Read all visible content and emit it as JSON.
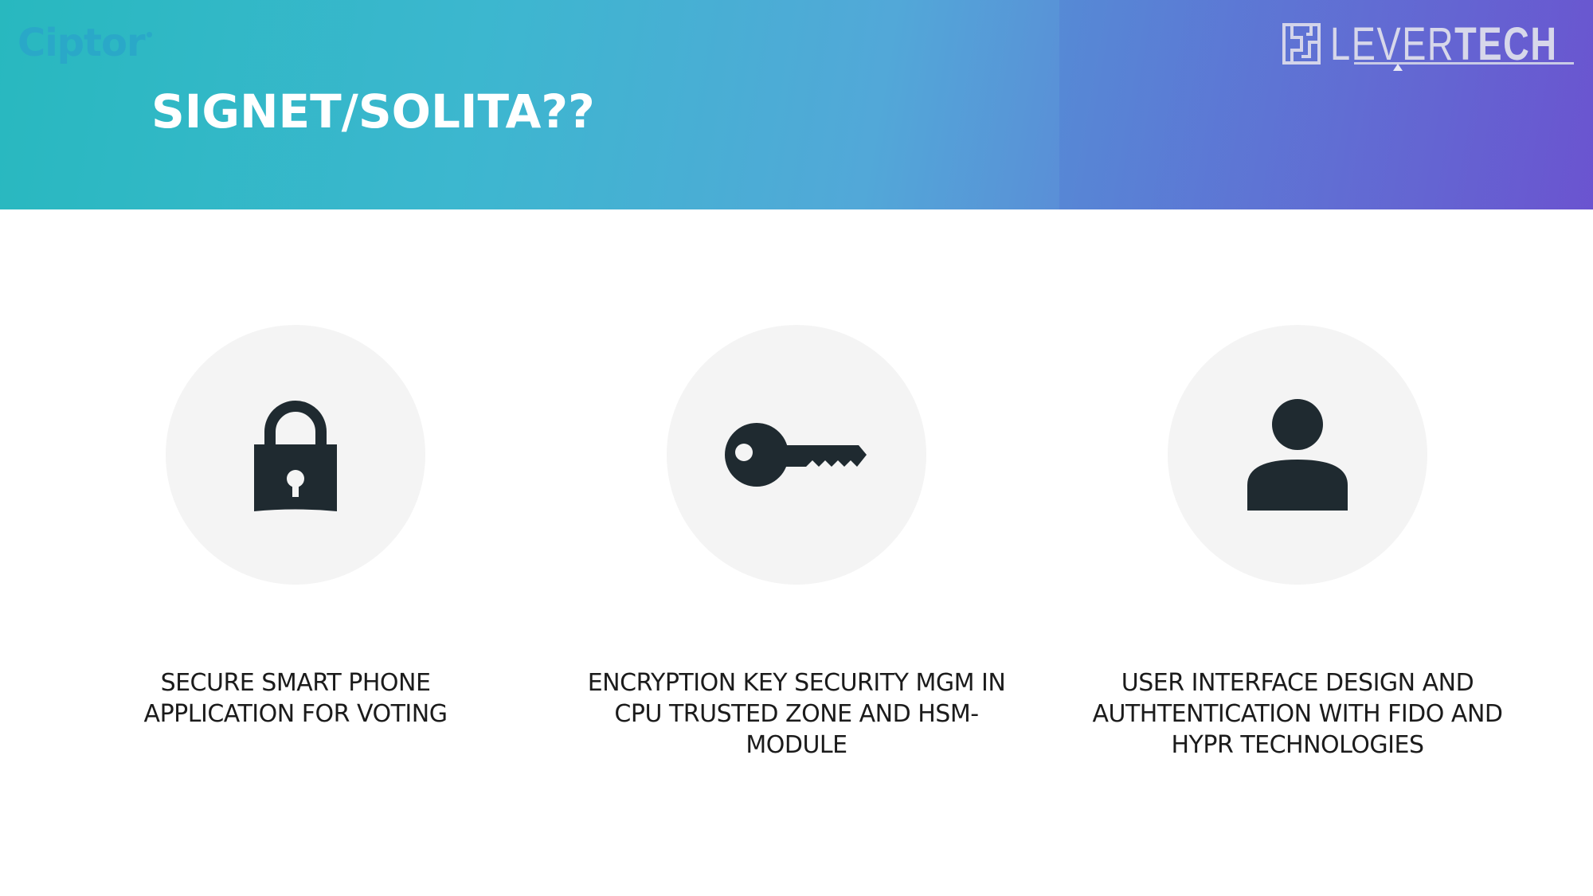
{
  "header": {
    "title": "SIGNET/SOLITA??",
    "left_logo_text": "Ciptor",
    "right_logo_text_light": "LEVER",
    "right_logo_text_bold": "TECH"
  },
  "features": [
    {
      "icon": "lock-icon",
      "caption": "SECURE SMART PHONE\nAPPLICATION FOR VOTING"
    },
    {
      "icon": "key-icon",
      "caption": "ENCRYPTION KEY SECURITY MGM IN\nCPU TRUSTED ZONE AND HSM-\nMODULE"
    },
    {
      "icon": "user-icon",
      "caption": "USER INTERFACE DESIGN AND\nAUTHTENTICATION WITH FIDO AND\nHYPR TECHNOLOGIES"
    }
  ],
  "colors": {
    "header_gradient_start": "#28b8bf",
    "header_gradient_end": "#6d55cf",
    "icon_fill": "#1f2a30",
    "circle_fill": "#f4f4f4"
  }
}
